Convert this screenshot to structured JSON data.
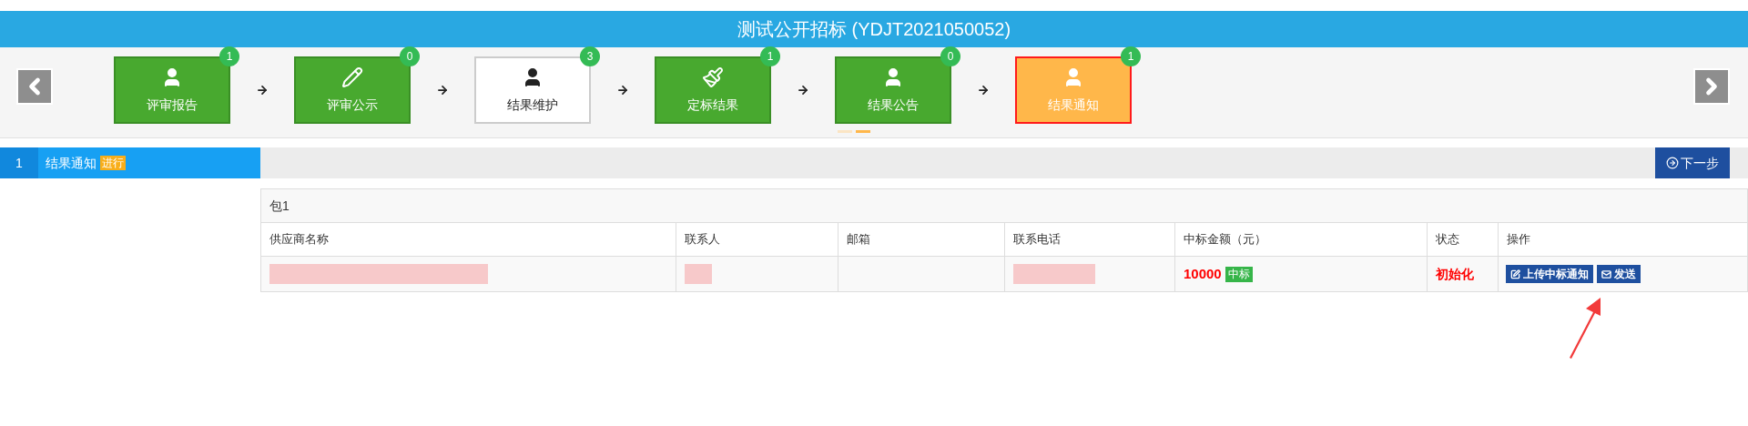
{
  "title": "测试公开招标 (YDJT2021050052)",
  "steps": [
    {
      "label": "评审报告",
      "count": "1",
      "completed": true,
      "selected": false
    },
    {
      "label": "评审公示",
      "count": "0",
      "completed": true,
      "selected": false
    },
    {
      "label": "结果维护",
      "count": "3",
      "completed": false,
      "selected": false
    },
    {
      "label": "定标结果",
      "count": "1",
      "completed": true,
      "selected": false
    },
    {
      "label": "结果公告",
      "count": "0",
      "completed": true,
      "selected": false
    },
    {
      "label": "结果通知",
      "count": "1",
      "completed": true,
      "selected": true
    }
  ],
  "pager": [
    {
      "selected": false
    },
    {
      "selected": true
    }
  ],
  "section": {
    "number": "1",
    "title": "结果通知",
    "badge": "进行",
    "next_button": "下一步"
  },
  "table": {
    "package": "包1",
    "columns": [
      "供应商名称",
      "联系人",
      "邮箱",
      "联系电话",
      "中标金额（元）",
      "状态",
      "操作"
    ],
    "rows": [
      {
        "supplier_redacted": true,
        "contact_redacted": true,
        "phone_redacted": true,
        "amount": "10000",
        "amount_tag": "中标",
        "status": "初始化",
        "actions": [
          "上传中标通知",
          "发送"
        ]
      }
    ]
  }
}
